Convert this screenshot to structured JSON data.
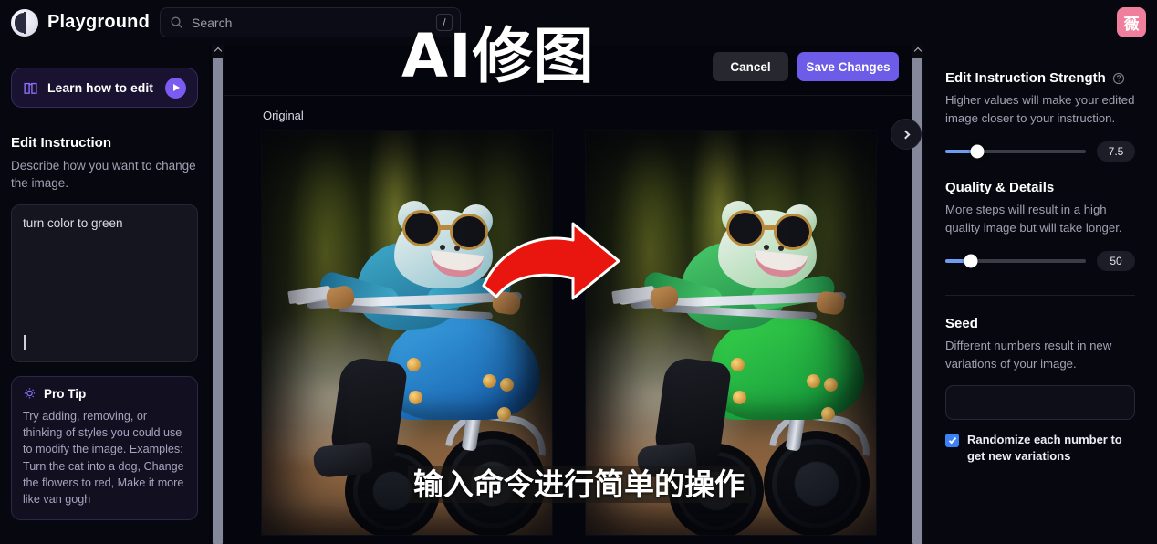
{
  "app": {
    "brand": "Playground",
    "logo_icon": "playground-logo-icon"
  },
  "search": {
    "placeholder": "Search",
    "icon": "search-icon",
    "shortcut_key": "/"
  },
  "account": {
    "avatar_char": "薇",
    "avatar_color": "#ef7f9d"
  },
  "sidebar": {
    "learn_button": {
      "label": "Learn how to edit",
      "book_icon": "book-icon",
      "play_icon": "play-icon"
    },
    "edit_instruction": {
      "title": "Edit Instruction",
      "description": "Describe how you want to change the image.",
      "value": "turn color to green"
    },
    "pro_tip": {
      "icon": "lightbulb-icon",
      "title": "Pro Tip",
      "body": "Try adding, removing, or thinking of styles you could use to modify the image. Examples: Turn the cat into a dog, Change the flowers to red, Make it more like van gogh"
    }
  },
  "canvas": {
    "cancel_label": "Cancel",
    "save_label": "Save Changes",
    "original_label": "Original",
    "next_icon": "chevron-right-icon",
    "original_image": "frog-wearing-goggles-riding-blue-motorcycle",
    "edited_image": "frog-wearing-goggles-riding-green-motorcycle",
    "arrow_annotation": "red-curved-arrow-icon"
  },
  "overlay": {
    "title": "AI修图",
    "caption": "输入命令进行简单的操作"
  },
  "settings": {
    "strength": {
      "title": "Edit Instruction Strength",
      "help_icon": "help-circle-icon",
      "description": "Higher values will make your edited image closer to your instruction.",
      "value": "7.5",
      "percent": 23
    },
    "quality": {
      "title": "Quality & Details",
      "description": "More steps will result in a high quality image but will take longer.",
      "value": "50",
      "percent": 18
    },
    "seed": {
      "title": "Seed",
      "description": "Different numbers result in new variations of your image.",
      "input_value": "",
      "input_placeholder": "",
      "randomize_label": "Randomize each number to get new variations",
      "randomize_checked": true
    }
  },
  "theme": {
    "accent": "#6c5ce7",
    "slider": "#6f9bf0",
    "checkbox": "#3b82f6",
    "background": "#07080f"
  }
}
